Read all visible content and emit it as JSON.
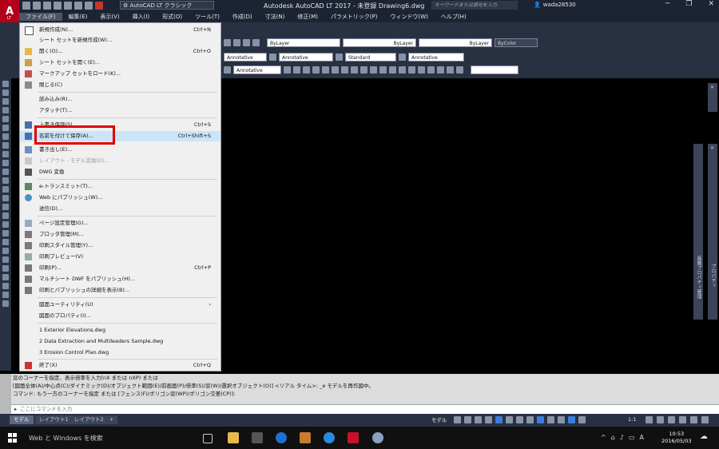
{
  "window": {
    "title": "Autodesk AutoCAD LT 2017 - 未登録   Drawing6.dwg",
    "workspace": "AutoCAD LT クラシック",
    "search_placeholder": "キーワードまたは語句を入力",
    "user": "wada28530"
  },
  "menubar": [
    "ファイル(F)",
    "編集(E)",
    "表示(V)",
    "挿入(I)",
    "形式(O)",
    "ツール(T)",
    "作成(D)",
    "寸法(N)",
    "修正(M)",
    "パラメトリック(P)",
    "ウィンドウ(W)",
    "ヘルプ(H)"
  ],
  "toolbar": {
    "layer_color": "ByLayer",
    "linetype": "ByLayer",
    "lineweight": "ByLayer",
    "plotstyle": "ByColor",
    "text_style": "Annotative",
    "dim_style": "Annotative",
    "table_style": "Standard",
    "mleader_style": "Annotative",
    "row3_style": "Annotative"
  },
  "file_menu": {
    "items": [
      {
        "label": "新規作成(N)...",
        "shortcut": "Ctrl+N",
        "disabled": false
      },
      {
        "label": "シート セットを新規作成(W)...",
        "shortcut": "",
        "disabled": false
      },
      {
        "label": "開く(O)...",
        "shortcut": "Ctrl+O",
        "disabled": false
      },
      {
        "label": "シート セットを開く(E)...",
        "shortcut": "",
        "disabled": false
      },
      {
        "label": "マークアップ セットをロード(K)...",
        "shortcut": "",
        "disabled": false
      },
      {
        "label": "閉じる(C)",
        "shortcut": "",
        "disabled": false
      },
      {
        "label": "読み込み(R)...",
        "shortcut": "",
        "disabled": false
      },
      {
        "label": "アタッチ(T)...",
        "shortcut": "",
        "disabled": false
      },
      {
        "label": "上書き保存(S)",
        "shortcut": "Ctrl+S",
        "disabled": false
      },
      {
        "label": "名前を付けて保存(A)...",
        "shortcut": "Ctrl+Shift+S",
        "disabled": false
      },
      {
        "label": "書き出し(E)...",
        "shortcut": "",
        "disabled": false
      },
      {
        "label": "レイアウト - モデル変換(D)...",
        "shortcut": "",
        "disabled": true
      },
      {
        "label": "DWG 変換",
        "shortcut": "",
        "disabled": false
      },
      {
        "label": "e-トランスミット(T)...",
        "shortcut": "",
        "disabled": false
      },
      {
        "label": "Web にパブリッシュ(W)...",
        "shortcut": "",
        "disabled": false
      },
      {
        "label": "送信(D)...",
        "shortcut": "",
        "disabled": false
      },
      {
        "label": "ページ設定管理(G)...",
        "shortcut": "",
        "disabled": false
      },
      {
        "label": "プロッタ管理(M)...",
        "shortcut": "",
        "disabled": false
      },
      {
        "label": "印刷スタイル管理(Y)...",
        "shortcut": "",
        "disabled": false
      },
      {
        "label": "印刷プレビュー(V)",
        "shortcut": "",
        "disabled": false
      },
      {
        "label": "印刷(P)...",
        "shortcut": "Ctrl+P",
        "disabled": false
      },
      {
        "label": "マルチシート DWF をパブリッシュ(H)...",
        "shortcut": "",
        "disabled": false
      },
      {
        "label": "印刷とパブリッシュの詳細を表示(B)...",
        "shortcut": "",
        "disabled": false
      },
      {
        "label": "図面ユーティリティ(U)",
        "shortcut": "›",
        "disabled": false
      },
      {
        "label": "図面のプロパティ(I)...",
        "shortcut": "",
        "disabled": false
      },
      {
        "label": "1 Exterior Elevations.dwg",
        "shortcut": "",
        "disabled": false
      },
      {
        "label": "2 Data Extraction and Multileaders Sample.dwg",
        "shortcut": "",
        "disabled": false
      },
      {
        "label": "3 Erosion Control Plan.dwg",
        "shortcut": "",
        "disabled": false
      },
      {
        "label": "終了(X)",
        "shortcut": "Ctrl+Q",
        "disabled": false
      }
    ]
  },
  "palettes": {
    "properties_label": "プロパティ",
    "layer_label": "画層プロパティ管理"
  },
  "command": {
    "history": [
      "窓のコーナーを指定、表示倍率を入力(nX または nXP) または",
      "[図面全体(A)/中心点(C)/ダイナミック(D)/オブジェクト範囲(E)/前画面(P)/倍率(S)/窓(W)/選択オブジェクト(O)] <リアル タイム>: _e モデルを再作図中。",
      "コマンド: もう一方のコーナーを指定 または [フェンス(F)/ポリゴン窓(WP)/ポリゴン交差(CP)]:"
    ],
    "placeholder": "ここにコマンドを入力"
  },
  "status": {
    "tabs": [
      "モデル",
      "レイアウト1",
      "レイアウト2",
      "+"
    ],
    "model_button": "モデル",
    "scale": "1:1"
  },
  "taskbar": {
    "search": "Web と Windows を検索",
    "ime": "A",
    "time": "10:53",
    "date": "2016/05/03"
  }
}
